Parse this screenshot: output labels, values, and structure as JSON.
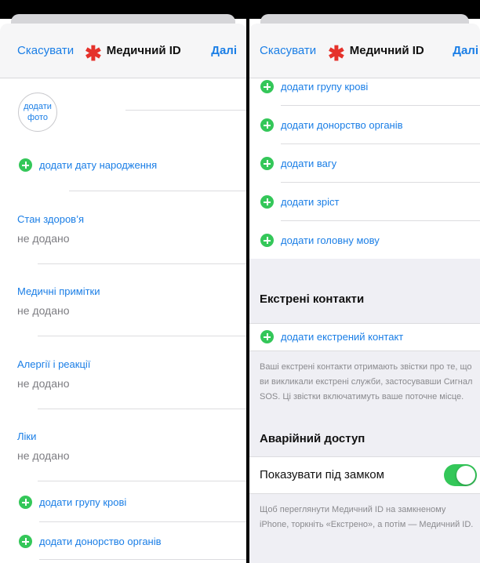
{
  "left": {
    "nav": {
      "cancel": "Скасувати",
      "title": "Медичний ID",
      "next": "Далі",
      "asterisk": "✱"
    },
    "photo": {
      "line1": "додати",
      "line2": "фото"
    },
    "add_birthdate": "додати дату народження",
    "fields": [
      {
        "label": "Стан здоров’я",
        "value": "не додано"
      },
      {
        "label": "Медичні примітки",
        "value": "не додано"
      },
      {
        "label": "Алергії і реакції",
        "value": "не додано"
      },
      {
        "label": "Ліки",
        "value": "не додано"
      }
    ],
    "add_items": [
      "додати групу крові",
      "додати донорство органів"
    ]
  },
  "right": {
    "nav": {
      "cancel": "Скасувати",
      "title": "Медичний ID",
      "next": "Далі",
      "asterisk": "✱"
    },
    "add_items": [
      "додати групу крові",
      "додати донорство органів",
      "додати вагу",
      "додати зріст",
      "додати головну мову"
    ],
    "emergency": {
      "header": "Екстрені контакти",
      "add_contact": "додати екстрений контакт",
      "note_lines": [
        "Ваші екстрені контакти отримають звістки про те, що",
        "ви викликали екстрені служби, застосувавши Сигнал",
        "SOS. Ці звістки включатимуть ваше поточне місце."
      ]
    },
    "access": {
      "header": "Аварійний доступ",
      "toggle_label": "Показувати під замком",
      "toggle_on": true,
      "note_lines": [
        "Щоб переглянути Медичний ID на замкненому",
        "iPhone, торкніть «Екстрено», а потім — Медичний ID."
      ]
    }
  },
  "colors": {
    "accent": "#1a7ee6",
    "green": "#34c759",
    "red": "#e5322b"
  }
}
